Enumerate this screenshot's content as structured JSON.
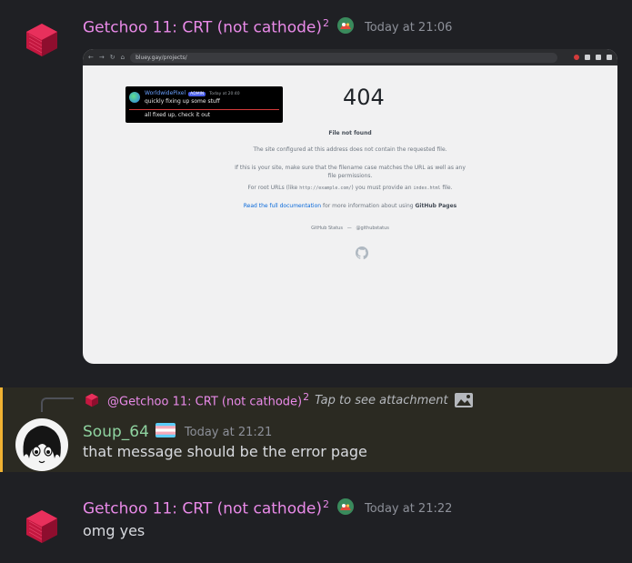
{
  "messages": [
    {
      "author": "Getchoo 11: CRT (not cathode)",
      "author_sup": "2",
      "timestamp": "Today at 21:06",
      "attachment": {
        "url": "bluey.gay/projects/",
        "quote": {
          "name": "WorldwidePixel",
          "badge": "ADMIN",
          "time": "Today at 20:40",
          "line1": "quickly fixing up some stuff",
          "line2": "all fixed up, check it out"
        },
        "page": {
          "code": "404",
          "title": "File not found",
          "p1": "The site configured at this address does not contain the requested file.",
          "p2a": "If this is your site, make sure that the filename case matches the URL as well as any",
          "p2b": "file permissions.",
          "p3a": "For root URLs (like",
          "p3code": "http://example.com/",
          "p3b": ") you must provide an",
          "p3code2": "index.html",
          "p3c": "file.",
          "doc_link": "Read the full documentation",
          "doc_rest": "for more information about using",
          "doc_bold": "GitHub Pages",
          "footer_left": "GitHub Status",
          "footer_sep": "—",
          "footer_right": "@githubstatus"
        }
      }
    },
    {
      "reply": {
        "mention": "@Getchoo 11: CRT (not cathode)",
        "mention_sup": "2",
        "text": "Tap to see attachment"
      },
      "author": "Soup_64",
      "timestamp": "Today at 21:21",
      "content": "that message should be the error page"
    },
    {
      "author": "Getchoo 11: CRT (not cathode)",
      "author_sup": "2",
      "timestamp": "Today at 21:22",
      "content": "omg yes"
    }
  ],
  "colors": {
    "background": "#1f2024",
    "author_getchoo": "#e98ae8",
    "author_soup": "#8fd3a0",
    "mention_highlight": "#2b2a22",
    "mention_bar": "#f0b232"
  },
  "icons": {
    "getchoo_avatar": "red-cube-icon",
    "flair": "parrot-emoji-icon",
    "soup_flag": "trans-flag-icon",
    "attachment": "image-icon"
  }
}
